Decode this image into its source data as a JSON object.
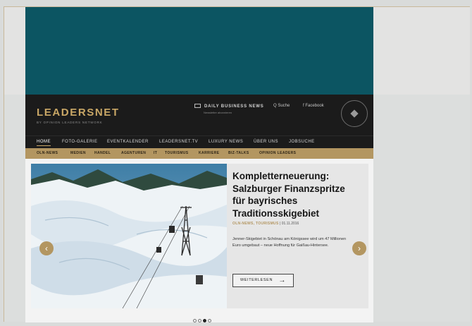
{
  "colors": {
    "ad_teal": "#0c5562",
    "brand_dark": "#1b1b1b",
    "gold": "#c9a766",
    "subnav_gold": "#b39661",
    "background_gray": "#d9dbda"
  },
  "header": {
    "logo": "LEADERSNET",
    "logo_sub": "by OPINION LEADERS NETWORK",
    "daily_news": "DAILY BUSINESS NEWS",
    "daily_news_sub": "Newsletter abonnieren",
    "search": "Q Suche",
    "facebook": "f Facebook",
    "seal_icon": "opinion-leaders-network-seal-icon"
  },
  "main_nav": [
    "HOME",
    "FOTO-GALERIE",
    "EVENTKALENDER",
    "LEADERSNET.TV",
    "LUXURY NEWS",
    "ÜBER UNS",
    "JOBSUCHE"
  ],
  "sub_nav": [
    "OLN-NEWS",
    "MEDIEN",
    "HANDEL",
    "AGENTUREN",
    "IT",
    "TOURISMUS",
    "KARRIERE",
    "BIZ-TALKS",
    "OPINION LEADERS"
  ],
  "article": {
    "headline": "Kompletterneuerung: Salzburger Finanzspritze für bayrisches Traditionsskigebiet",
    "categories": "OLN-NEWS, TOURISMUS",
    "date": "| 01.11.2016",
    "teaser": "Jenner-Skigebiet in Schönau am Königssee wird um 47 Millionen Euro umgebaut – neue Hoffnung für Gaißau-Hintersee.",
    "read_more": "WEITERLESEN",
    "read_more_icon": "arrow-right-icon",
    "image": "ski-resort-winter-landscape-with-cable-car"
  },
  "slider": {
    "prev_icon": "chevron-left-icon",
    "next_icon": "chevron-right-icon",
    "slide_count": 4,
    "active_slide": 3
  }
}
